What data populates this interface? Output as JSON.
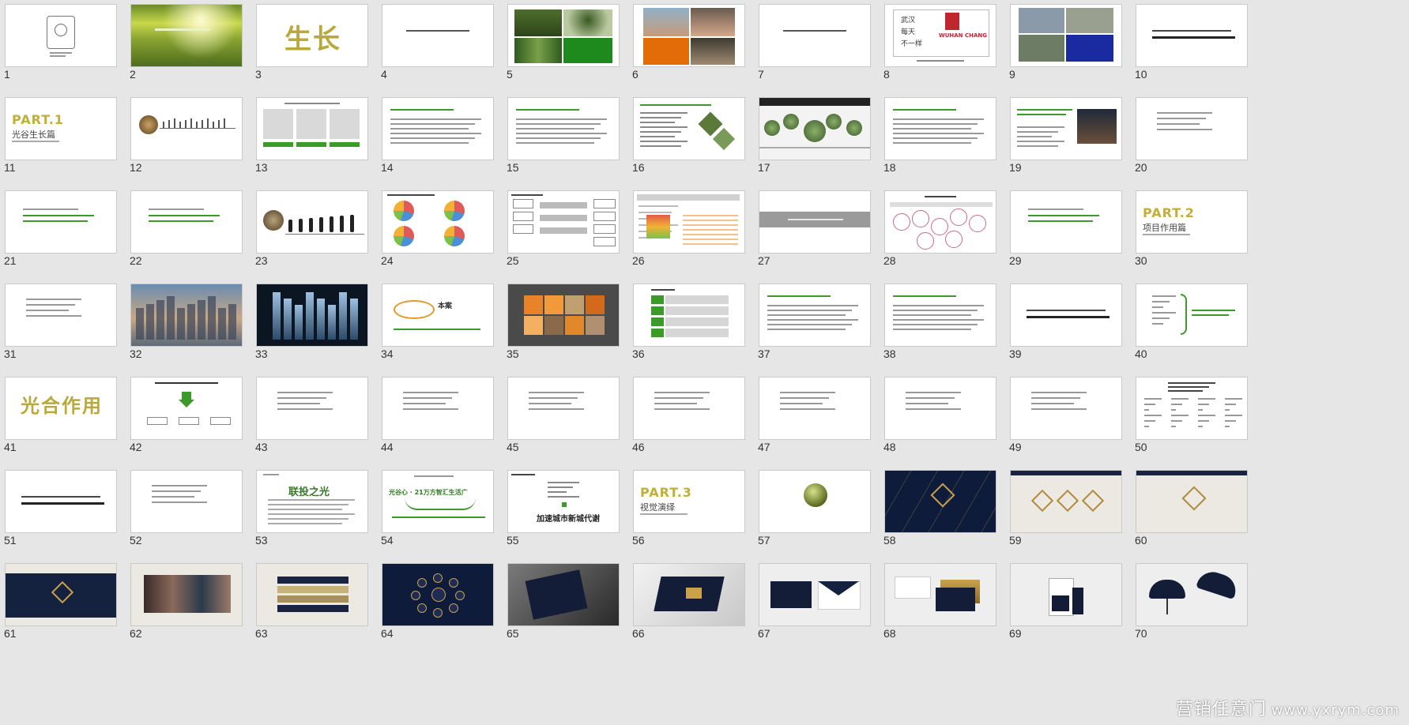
{
  "slides": [
    {
      "n": "1",
      "kind": "logo"
    },
    {
      "n": "2",
      "kind": "forest"
    },
    {
      "n": "3",
      "kind": "bigtext",
      "text": "生长"
    },
    {
      "n": "4",
      "kind": "textline"
    },
    {
      "n": "5",
      "kind": "photos-green"
    },
    {
      "n": "6",
      "kind": "photos-kids"
    },
    {
      "n": "7",
      "kind": "textline"
    },
    {
      "n": "8",
      "kind": "wuhan",
      "lines": [
        "武汉",
        "每天",
        "不一样"
      ],
      "logo": "WUHAN CHANG"
    },
    {
      "n": "9",
      "kind": "city-photos"
    },
    {
      "n": "10",
      "kind": "textbold"
    },
    {
      "n": "11",
      "kind": "part",
      "part": "PART.1",
      "sub": "光谷生长篇"
    },
    {
      "n": "12",
      "kind": "timeline"
    },
    {
      "n": "13",
      "kind": "boxes3"
    },
    {
      "n": "14",
      "kind": "greentitle"
    },
    {
      "n": "15",
      "kind": "greentitle"
    },
    {
      "n": "16",
      "kind": "greenlist"
    },
    {
      "n": "17",
      "kind": "circles"
    },
    {
      "n": "18",
      "kind": "greentitle"
    },
    {
      "n": "19",
      "kind": "greenphoto"
    },
    {
      "n": "20",
      "kind": "smalltext"
    },
    {
      "n": "21",
      "kind": "greentext"
    },
    {
      "n": "22",
      "kind": "greentext"
    },
    {
      "n": "23",
      "kind": "evolution"
    },
    {
      "n": "24",
      "kind": "pies"
    },
    {
      "n": "25",
      "kind": "flow"
    },
    {
      "n": "26",
      "kind": "table"
    },
    {
      "n": "27",
      "kind": "graybar"
    },
    {
      "n": "28",
      "kind": "bubbles"
    },
    {
      "n": "29",
      "kind": "greentext"
    },
    {
      "n": "30",
      "kind": "part",
      "part": "PART.2",
      "sub": "项目作用篇"
    },
    {
      "n": "31",
      "kind": "smalltext"
    },
    {
      "n": "32",
      "kind": "building-dusk"
    },
    {
      "n": "33",
      "kind": "building-night"
    },
    {
      "n": "34",
      "kind": "orbit",
      "label": "本案"
    },
    {
      "n": "35",
      "kind": "collage"
    },
    {
      "n": "36",
      "kind": "greenrows"
    },
    {
      "n": "37",
      "kind": "greentitle"
    },
    {
      "n": "38",
      "kind": "greentitle"
    },
    {
      "n": "39",
      "kind": "textbold"
    },
    {
      "n": "40",
      "kind": "brace"
    },
    {
      "n": "41",
      "kind": "bigtext",
      "text": "光合作用"
    },
    {
      "n": "42",
      "kind": "arrowdiagram"
    },
    {
      "n": "43",
      "kind": "smalltext"
    },
    {
      "n": "44",
      "kind": "smalltext"
    },
    {
      "n": "45",
      "kind": "smalltext"
    },
    {
      "n": "46",
      "kind": "smalltext"
    },
    {
      "n": "47",
      "kind": "smalltext"
    },
    {
      "n": "48",
      "kind": "smalltext"
    },
    {
      "n": "49",
      "kind": "smalltext"
    },
    {
      "n": "50",
      "kind": "tree"
    },
    {
      "n": "51",
      "kind": "textbold"
    },
    {
      "n": "52",
      "kind": "smalltext"
    },
    {
      "n": "53",
      "kind": "greenheadline",
      "text": "联投之光"
    },
    {
      "n": "54",
      "kind": "slogan",
      "text": "光谷心 · 21万方智汇生活广"
    },
    {
      "n": "55",
      "kind": "slogan2",
      "text": "加速城市新城代谢"
    },
    {
      "n": "56",
      "kind": "part",
      "part": "PART.3",
      "sub": "视觉演绎"
    },
    {
      "n": "57",
      "kind": "goldcircle"
    },
    {
      "n": "58",
      "kind": "navy"
    },
    {
      "n": "59",
      "kind": "goldmarks"
    },
    {
      "n": "60",
      "kind": "goldmark"
    },
    {
      "n": "61",
      "kind": "navy-band"
    },
    {
      "n": "62",
      "kind": "photo-band"
    },
    {
      "n": "63",
      "kind": "stripes"
    },
    {
      "n": "64",
      "kind": "navy-icons"
    },
    {
      "n": "65",
      "kind": "book"
    },
    {
      "n": "66",
      "kind": "box"
    },
    {
      "n": "67",
      "kind": "envelope"
    },
    {
      "n": "68",
      "kind": "cards"
    },
    {
      "n": "69",
      "kind": "bag"
    },
    {
      "n": "70",
      "kind": "umbrella"
    }
  ],
  "watermark": {
    "brand": "营销任意门",
    "url": "www.yxrym.com"
  }
}
